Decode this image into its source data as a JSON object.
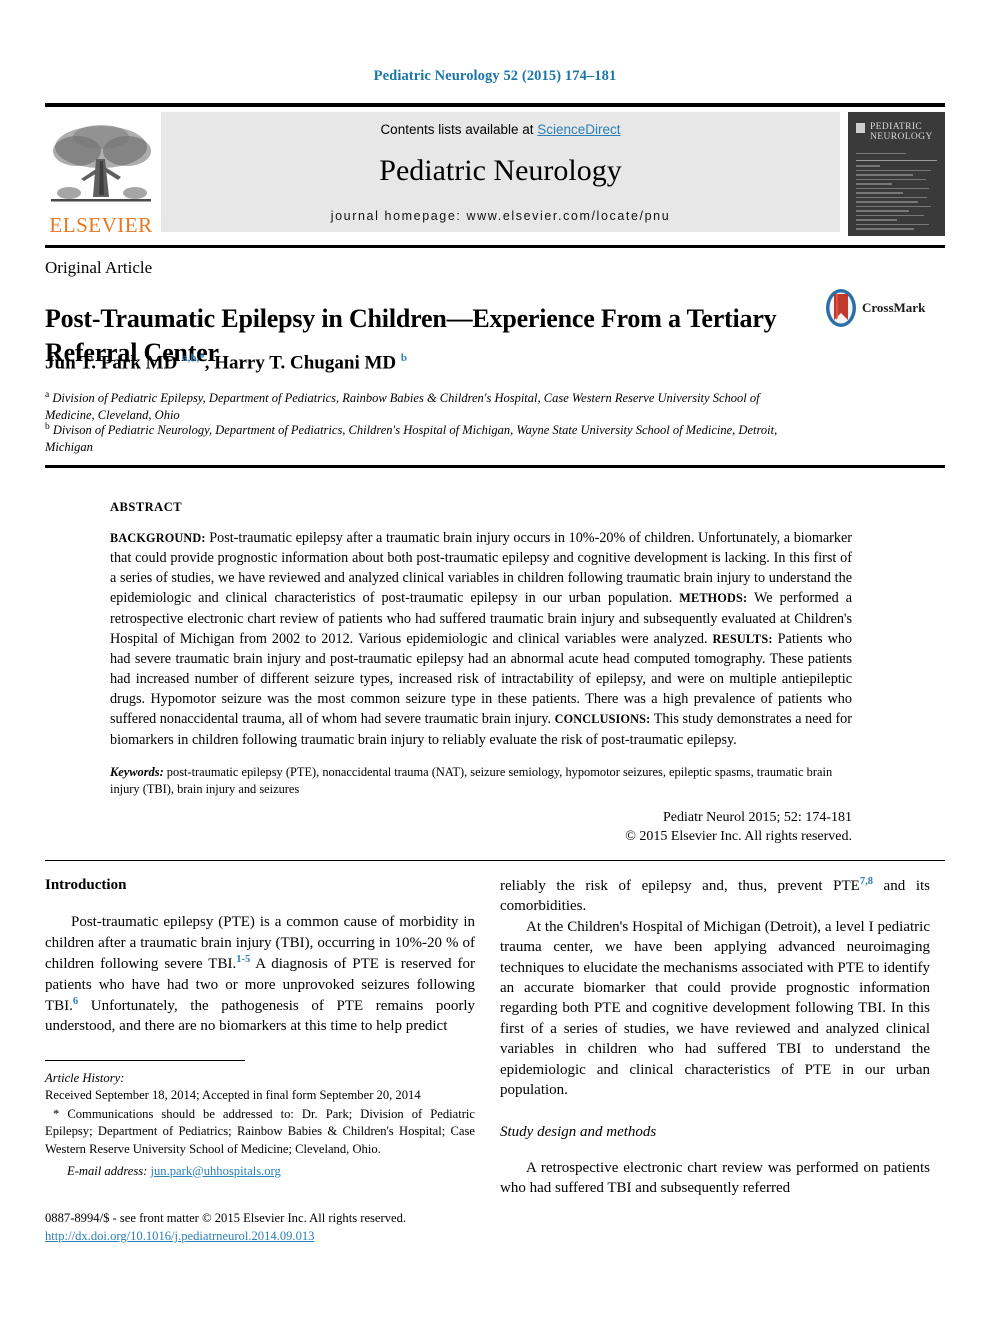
{
  "running_head": "Pediatric Neurology 52 (2015) 174–181",
  "masthead": {
    "contents_prefix": "Contents lists available at ",
    "sciencedirect": "ScienceDirect",
    "journal_title": "Pediatric Neurology",
    "homepage": "journal homepage: www.elsevier.com/locate/pnu",
    "publisher_logo_text": "ELSEVIER",
    "cover_title_line1": "PEDIATRIC",
    "cover_title_line2": "NEUROLOGY"
  },
  "article": {
    "type": "Original Article",
    "title": "Post-Traumatic Epilepsy in Children—Experience From a Tertiary Referral Center",
    "crossmark_label": "CrossMark",
    "authors_html": "Jun T. Park MD <sup>a,b,</sup><sup>*</sup>, Harry T. Chugani MD <sup>b</sup>",
    "affiliation_a": "Division of Pediatric Epilepsy, Department of Pediatrics, Rainbow Babies & Children's Hospital, Case Western Reserve University School of Medicine, Cleveland, Ohio",
    "affiliation_b": "Divison of Pediatric Neurology, Department of Pediatrics, Children's Hospital of Michigan, Wayne State University School of Medicine, Detroit, Michigan"
  },
  "abstract": {
    "label": "ABSTRACT",
    "background_label": "BACKGROUND:",
    "background_text": " Post-traumatic epilepsy after a traumatic brain injury occurs in 10%-20% of children. Unfortunately, a biomarker that could provide prognostic information about both post-traumatic epilepsy and cognitive development is lacking. In this first of a series of studies, we have reviewed and analyzed clinical variables in children following traumatic brain injury to understand the epidemiologic and clinical characteristics of post-traumatic epilepsy in our urban population. ",
    "methods_label": "METHODS:",
    "methods_text": " We performed a retrospective electronic chart review of patients who had suffered traumatic brain injury and subsequently evaluated at Children's Hospital of Michigan from 2002 to 2012. Various epidemiologic and clinical variables were analyzed. ",
    "results_label": "RESULTS:",
    "results_text": " Patients who had severe traumatic brain injury and post-traumatic epilepsy had an abnormal acute head computed tomography. These patients had increased number of different seizure types, increased risk of intractability of epilepsy, and were on multiple antiepileptic drugs. Hypomotor seizure was the most common seizure type in these patients. There was a high prevalence of patients who suffered nonaccidental trauma, all of whom had severe traumatic brain injury. ",
    "conclusions_label": "CONCLUSIONS:",
    "conclusions_text": " This study demonstrates a need for biomarkers in children following traumatic brain injury to reliably evaluate the risk of post-traumatic epilepsy.",
    "keywords_label": "Keywords:",
    "keywords_text": " post-traumatic epilepsy (PTE), nonaccidental trauma (NAT), seizure semiology, hypomotor seizures, epileptic spasms, traumatic brain injury (TBI), brain injury and seizures",
    "citation": "Pediatr Neurol 2015; 52: 174-181",
    "copyright": "© 2015 Elsevier Inc. All rights reserved."
  },
  "body": {
    "intro_heading": "Introduction",
    "intro_p1_a": "Post-traumatic epilepsy (PTE) is a common cause of morbidity in children after a traumatic brain injury (TBI), occurring in 10%-20 % of children following severe TBI.",
    "intro_p1_ref1": "1-5",
    "intro_p1_b": " A diagnosis of PTE is reserved for patients who have had two or more unprovoked seizures following TBI.",
    "intro_p1_ref2": "6",
    "intro_p1_c": " Unfortunately, the pathogenesis of PTE remains poorly understood, and there are no biomarkers at this time to help predict",
    "right_p1_a": "reliably the risk of epilepsy and, thus, prevent PTE",
    "right_p1_ref": "7,8",
    "right_p1_b": " and its comorbidities.",
    "right_p2": "At the Children's Hospital of Michigan (Detroit), a level I pediatric trauma center, we have been applying advanced neuroimaging techniques to elucidate the mechanisms associated with PTE to identify an accurate biomarker that could provide prognostic information regarding both PTE and cognitive development following TBI. In this first of a series of studies, we have reviewed and analyzed clinical variables in children who had suffered TBI to understand the epidemiologic and clinical characteristics of PTE in our urban population.",
    "methods_heading": "Study design and methods",
    "methods_p1": "A retrospective electronic chart review was performed on patients who had suffered TBI and subsequently referred"
  },
  "footnotes": {
    "history_label": "Article History:",
    "history_text": "Received September 18, 2014; Accepted in final form September 20, 2014",
    "correspondence": "* Communications should be addressed to: Dr. Park; Division of Pediatric Epilepsy; Department of Pediatrics; Rainbow Babies & Children's Hospital; Case Western Reserve University School of Medicine; Cleveland, Ohio.",
    "email_label": "E-mail address:",
    "email": "jun.park@uhhospitals.org"
  },
  "bottom": {
    "issn_line": "0887-8994/$ - see front matter © 2015 Elsevier Inc. All rights reserved.",
    "doi": "http://dx.doi.org/10.1016/j.pediatrneurol.2014.09.013"
  },
  "colors": {
    "link_blue": "#2a7fb8",
    "elsevier_orange": "#e87722",
    "banner_gray": "#e7e7e7",
    "cover_dark": "#3a3a3a",
    "crossmark_blue": "#2a6fa8",
    "crossmark_red": "#c0392b"
  }
}
